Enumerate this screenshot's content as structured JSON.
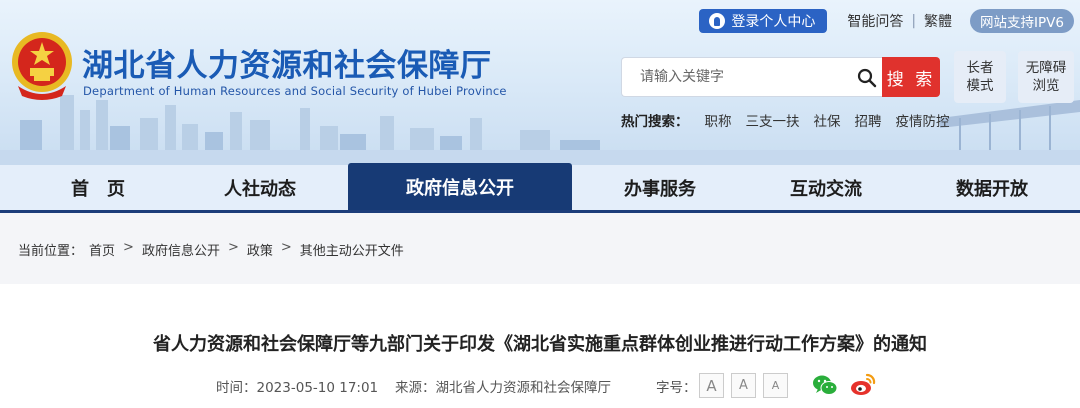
{
  "header": {
    "site_title": "湖北省人力资源和社会保障厅",
    "site_subtitle": "Department of Human Resources and Social Security of Hubei Province",
    "login_label": "登录个人中心",
    "smart_qa": "智能问答",
    "separator": "|",
    "traditional": "繁體",
    "ipv6": "网站支持IPV6",
    "search_placeholder": "请输入关键字",
    "search_button": "搜 索",
    "elder_mode": [
      "长者",
      "模式"
    ],
    "accessible_mode": [
      "无障碍",
      "浏览"
    ],
    "hot_label": "热门搜索：",
    "hot_keywords": [
      "职称",
      "三支一扶",
      "社保",
      "招聘",
      "疫情防控"
    ]
  },
  "nav": {
    "items": [
      "首　页",
      "人社动态",
      "政府信息公开",
      "办事服务",
      "互动交流",
      "数据开放"
    ],
    "active_index": 2
  },
  "breadcrumb": {
    "prefix": "当前位置：",
    "items": [
      "首页",
      "政府信息公开",
      "政策",
      "其他主动公开文件"
    ],
    "divider": ">"
  },
  "article": {
    "title": "省人力资源和社会保障厅等九部门关于印发《湖北省实施重点群体创业推进行动工作方案》的通知",
    "time": "时间：2023-05-10 17:01",
    "source": "来源：湖北省人力资源和社会保障厅",
    "font_size_label": "字号：",
    "font_sizes": [
      "A",
      "A",
      "A"
    ]
  },
  "icons": {
    "login": "user-icon",
    "search": "search-icon",
    "wechat": "wechat-icon",
    "weibo": "weibo-icon",
    "emblem": "national-emblem-icon"
  },
  "colors": {
    "brand_blue": "#1a5bb5",
    "nav_active": "#173a75",
    "search_red": "#e0322d",
    "wechat_green": "#2aae3b",
    "weibo_orange": "#f39c12"
  }
}
